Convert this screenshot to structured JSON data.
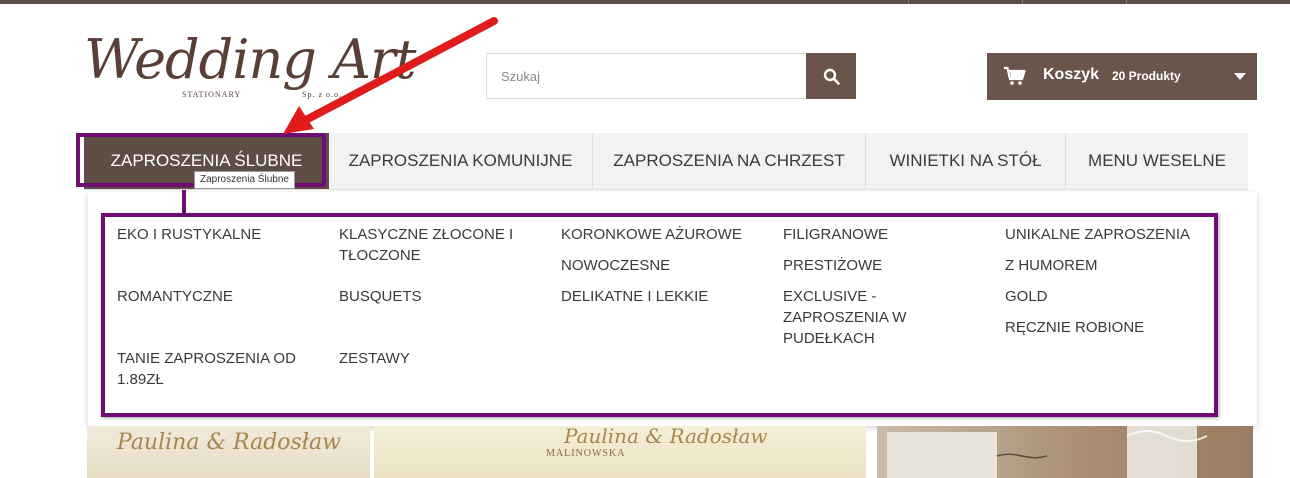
{
  "logo": {
    "title": "Wedding Art",
    "sub_left": "STATIONARY",
    "sub_right": "Sp. z o.o."
  },
  "search": {
    "placeholder": "Szukaj",
    "icon": "search-icon"
  },
  "cart": {
    "label": "Koszyk",
    "count": "20 Produkty",
    "icon": "cart-icon"
  },
  "nav": {
    "items": [
      {
        "label": "ZAPROSZENIA ŚLUBNE",
        "active": true
      },
      {
        "label": "ZAPROSZENIA KOMUNIJNE"
      },
      {
        "label": "ZAPROSZENIA NA CHRZEST"
      },
      {
        "label": "WINIETKI NA STÓŁ"
      },
      {
        "label": "MENU WESELNE"
      }
    ],
    "tooltip": "Zaproszenia Ślubne"
  },
  "dropdown": {
    "links": [
      "EKO I RUSTYKALNE",
      "KLASYCZNE ZŁOCONE I TŁOCZONE",
      "KORONKOWE AŻUROWE",
      "FILIGRANOWE",
      "UNIKALNE ZAPROSZENIA",
      "NOWOCZESNE",
      "PRESTIŻOWE",
      "Z HUMOREM",
      "ROMANTYCZNE",
      "BUSQUETS",
      "DELIKATNE I LEKKIE",
      "EXCLUSIVE - ZAPROSZENIA W PUDEŁKACH",
      "GOLD",
      "RĘCZNIE ROBIONE",
      "TANIE ZAPROSZENIA OD 1.89ZŁ",
      "ZESTAWY"
    ]
  },
  "banners": {
    "card_script": "Paulina & Radosław",
    "card_surname": "MALINOWSKA"
  },
  "colors": {
    "brand_brown": "#5e4d45",
    "highlight_purple": "#6e0e74",
    "arrow_red": "#e01b1b"
  }
}
